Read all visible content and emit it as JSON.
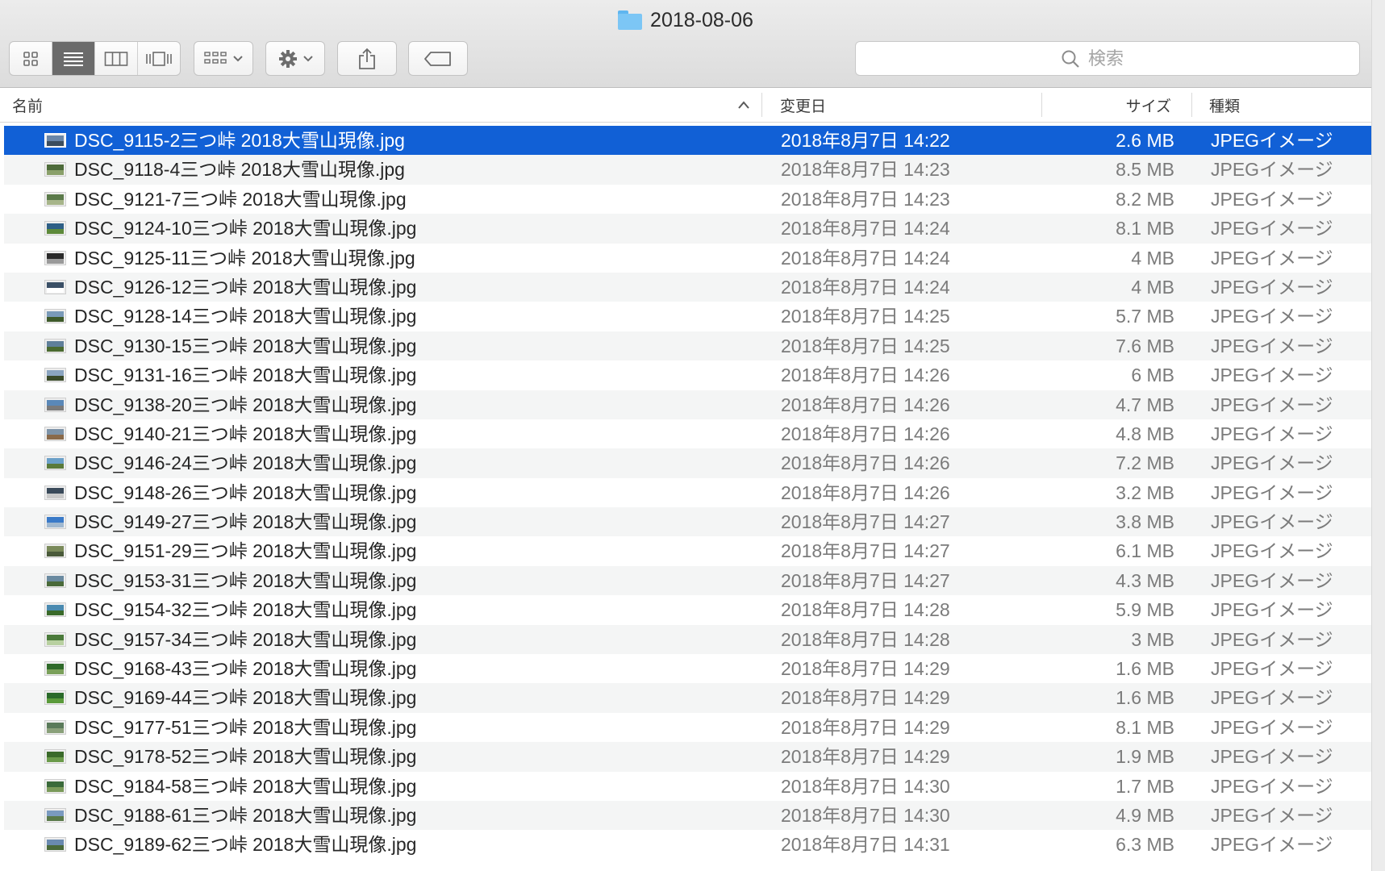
{
  "window": {
    "title": "2018-08-06"
  },
  "toolbar": {
    "view_icon": "icon-view-icon",
    "list_view": "list-view-icon",
    "column_view": "column-view-icon",
    "cover_flow": "cover-flow-icon",
    "group_icon": "group-icon",
    "action_icon": "gear-icon",
    "share_icon": "share-icon",
    "tag_icon": "tag-icon"
  },
  "search": {
    "placeholder": "検索"
  },
  "columns": {
    "name": "名前",
    "date": "変更日",
    "size": "サイズ",
    "kind": "種類"
  },
  "files": [
    {
      "name": "DSC_9115-2三つ峠 2018大雪山現像.jpg",
      "date": "2018年8月7日 14:22",
      "size": "2.6 MB",
      "kind": "JPEGイメージ"
    },
    {
      "name": "DSC_9118-4三つ峠 2018大雪山現像.jpg",
      "date": "2018年8月7日 14:23",
      "size": "8.5 MB",
      "kind": "JPEGイメージ"
    },
    {
      "name": "DSC_9121-7三つ峠 2018大雪山現像.jpg",
      "date": "2018年8月7日 14:23",
      "size": "8.2 MB",
      "kind": "JPEGイメージ"
    },
    {
      "name": "DSC_9124-10三つ峠 2018大雪山現像.jpg",
      "date": "2018年8月7日 14:24",
      "size": "8.1 MB",
      "kind": "JPEGイメージ"
    },
    {
      "name": "DSC_9125-11三つ峠 2018大雪山現像.jpg",
      "date": "2018年8月7日 14:24",
      "size": "4 MB",
      "kind": "JPEGイメージ"
    },
    {
      "name": "DSC_9126-12三つ峠 2018大雪山現像.jpg",
      "date": "2018年8月7日 14:24",
      "size": "4 MB",
      "kind": "JPEGイメージ"
    },
    {
      "name": "DSC_9128-14三つ峠 2018大雪山現像.jpg",
      "date": "2018年8月7日 14:25",
      "size": "5.7 MB",
      "kind": "JPEGイメージ"
    },
    {
      "name": "DSC_9130-15三つ峠 2018大雪山現像.jpg",
      "date": "2018年8月7日 14:25",
      "size": "7.6 MB",
      "kind": "JPEGイメージ"
    },
    {
      "name": "DSC_9131-16三つ峠 2018大雪山現像.jpg",
      "date": "2018年8月7日 14:26",
      "size": "6 MB",
      "kind": "JPEGイメージ"
    },
    {
      "name": "DSC_9138-20三つ峠 2018大雪山現像.jpg",
      "date": "2018年8月7日 14:26",
      "size": "4.7 MB",
      "kind": "JPEGイメージ"
    },
    {
      "name": "DSC_9140-21三つ峠 2018大雪山現像.jpg",
      "date": "2018年8月7日 14:26",
      "size": "4.8 MB",
      "kind": "JPEGイメージ"
    },
    {
      "name": "DSC_9146-24三つ峠 2018大雪山現像.jpg",
      "date": "2018年8月7日 14:26",
      "size": "7.2 MB",
      "kind": "JPEGイメージ"
    },
    {
      "name": "DSC_9148-26三つ峠 2018大雪山現像.jpg",
      "date": "2018年8月7日 14:26",
      "size": "3.2 MB",
      "kind": "JPEGイメージ"
    },
    {
      "name": "DSC_9149-27三つ峠 2018大雪山現像.jpg",
      "date": "2018年8月7日 14:27",
      "size": "3.8 MB",
      "kind": "JPEGイメージ"
    },
    {
      "name": "DSC_9151-29三つ峠 2018大雪山現像.jpg",
      "date": "2018年8月7日 14:27",
      "size": "6.1 MB",
      "kind": "JPEGイメージ"
    },
    {
      "name": "DSC_9153-31三つ峠 2018大雪山現像.jpg",
      "date": "2018年8月7日 14:27",
      "size": "4.3 MB",
      "kind": "JPEGイメージ"
    },
    {
      "name": "DSC_9154-32三つ峠 2018大雪山現像.jpg",
      "date": "2018年8月7日 14:28",
      "size": "5.9 MB",
      "kind": "JPEGイメージ"
    },
    {
      "name": "DSC_9157-34三つ峠 2018大雪山現像.jpg",
      "date": "2018年8月7日 14:28",
      "size": "3 MB",
      "kind": "JPEGイメージ"
    },
    {
      "name": "DSC_9168-43三つ峠 2018大雪山現像.jpg",
      "date": "2018年8月7日 14:29",
      "size": "1.6 MB",
      "kind": "JPEGイメージ"
    },
    {
      "name": "DSC_9169-44三つ峠 2018大雪山現像.jpg",
      "date": "2018年8月7日 14:29",
      "size": "1.6 MB",
      "kind": "JPEGイメージ"
    },
    {
      "name": "DSC_9177-51三つ峠 2018大雪山現像.jpg",
      "date": "2018年8月7日 14:29",
      "size": "8.1 MB",
      "kind": "JPEGイメージ"
    },
    {
      "name": "DSC_9178-52三つ峠 2018大雪山現像.jpg",
      "date": "2018年8月7日 14:29",
      "size": "1.9 MB",
      "kind": "JPEGイメージ"
    },
    {
      "name": "DSC_9184-58三つ峠 2018大雪山現像.jpg",
      "date": "2018年8月7日 14:30",
      "size": "1.7 MB",
      "kind": "JPEGイメージ"
    },
    {
      "name": "DSC_9188-61三つ峠 2018大雪山現像.jpg",
      "date": "2018年8月7日 14:30",
      "size": "4.9 MB",
      "kind": "JPEGイメージ"
    },
    {
      "name": "DSC_9189-62三つ峠 2018大雪山現像.jpg",
      "date": "2018年8月7日 14:31",
      "size": "6.3 MB",
      "kind": "JPEGイメージ"
    }
  ],
  "selected_row": 0,
  "colors": {
    "selection": "#1160d6",
    "toolbar": "#dcdcdc",
    "folder": "#7cc6f5"
  }
}
